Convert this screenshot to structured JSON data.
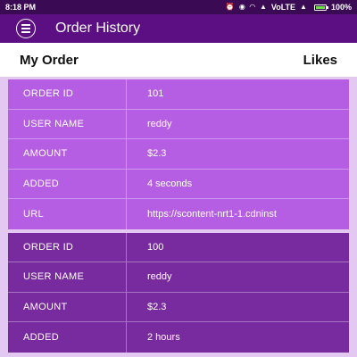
{
  "status_bar": {
    "time": "8:18 PM",
    "network": "VoLTE",
    "battery": "100%"
  },
  "app_bar": {
    "title": "Order History"
  },
  "tabs": [
    {
      "label": "My Order"
    },
    {
      "label": "Likes"
    }
  ],
  "orders": [
    {
      "rows": [
        {
          "key": "ORDER ID",
          "value": "101"
        },
        {
          "key": "USER NAME",
          "value": "reddy"
        },
        {
          "key": "AMOUNT",
          "value": "$2.3"
        },
        {
          "key": "ADDED",
          "value": "4 seconds"
        },
        {
          "key": "URL",
          "value": "https://scontent-nrt1-1.cdninst"
        }
      ]
    },
    {
      "rows": [
        {
          "key": "ORDER ID",
          "value": "100"
        },
        {
          "key": "USER NAME",
          "value": "reddy"
        },
        {
          "key": "AMOUNT",
          "value": "$2.3"
        },
        {
          "key": "ADDED",
          "value": "2 hours"
        }
      ]
    }
  ]
}
